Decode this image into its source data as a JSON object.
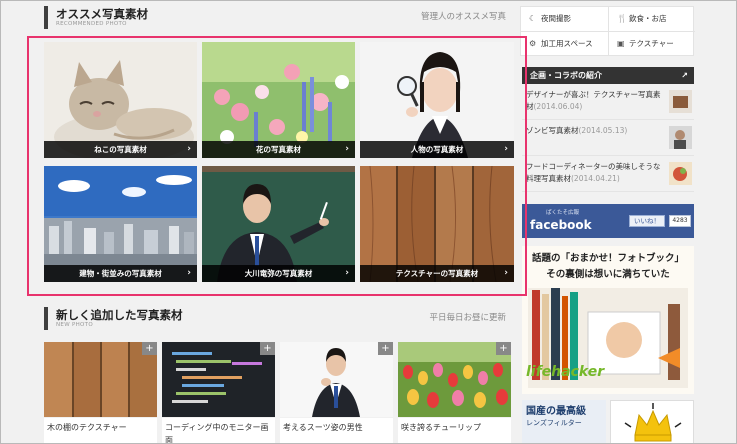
{
  "recommended": {
    "title": "オススメ写真素材",
    "subtitle": "RECOMMENDED PHOTO",
    "note": "管理人のオススメ写真",
    "tiles": [
      {
        "label": "ねこの写真素材"
      },
      {
        "label": "花の写真素材"
      },
      {
        "label": "人物の写真素材"
      },
      {
        "label": "建物・街並みの写真素材"
      },
      {
        "label": "大川竜弥の写真素材"
      },
      {
        "label": "テクスチャーの写真素材"
      }
    ],
    "arrow": "›"
  },
  "new_photos": {
    "title": "新しく追加した写真素材",
    "subtitle": "NEW PHOTO",
    "note": "平日毎日お昼に更新",
    "plus": "+",
    "items": [
      {
        "label": "木の棚のテクスチャー"
      },
      {
        "label": "コーディング中のモニター画面"
      },
      {
        "label": "考えるスーツ姿の男性"
      },
      {
        "label": "咲き誇るチューリップ"
      }
    ]
  },
  "sidebar": {
    "categories": [
      {
        "label": "夜間撮影",
        "icon": "moon-icon"
      },
      {
        "label": "飲食・お店",
        "icon": "cutlery-icon"
      },
      {
        "label": "加工用スペース",
        "icon": "gear-icon"
      },
      {
        "label": "テクスチャー",
        "icon": "image-icon"
      }
    ],
    "collab": {
      "title": "企画・コラボの紹介",
      "items": [
        {
          "text": "デザイナーが喜ぶ！テクスチャー写真素材",
          "date": "(2014.06.04)"
        },
        {
          "text": "ゾンビ写真素材",
          "date": "(2014.05.13)"
        },
        {
          "text": "フードコーディネーターの美味しそうな料理写真素材",
          "date": "(2014.04.21)"
        }
      ]
    },
    "facebook": {
      "small": "ぱくたそ広報",
      "brand": "facebook",
      "like": "いいね！",
      "count": "4283"
    },
    "ad1": {
      "line1": "話題の「おまかせ！フォトブック」",
      "line2": "その裏側は想いに満ちていた",
      "brand": "lifehacker"
    },
    "ad2": {
      "line1": "国産の最高級",
      "line2": "レンズフィルター"
    }
  },
  "colors": {
    "highlight": "#e8336d",
    "caption_bg": "#000000",
    "facebook": "#3b5998"
  }
}
